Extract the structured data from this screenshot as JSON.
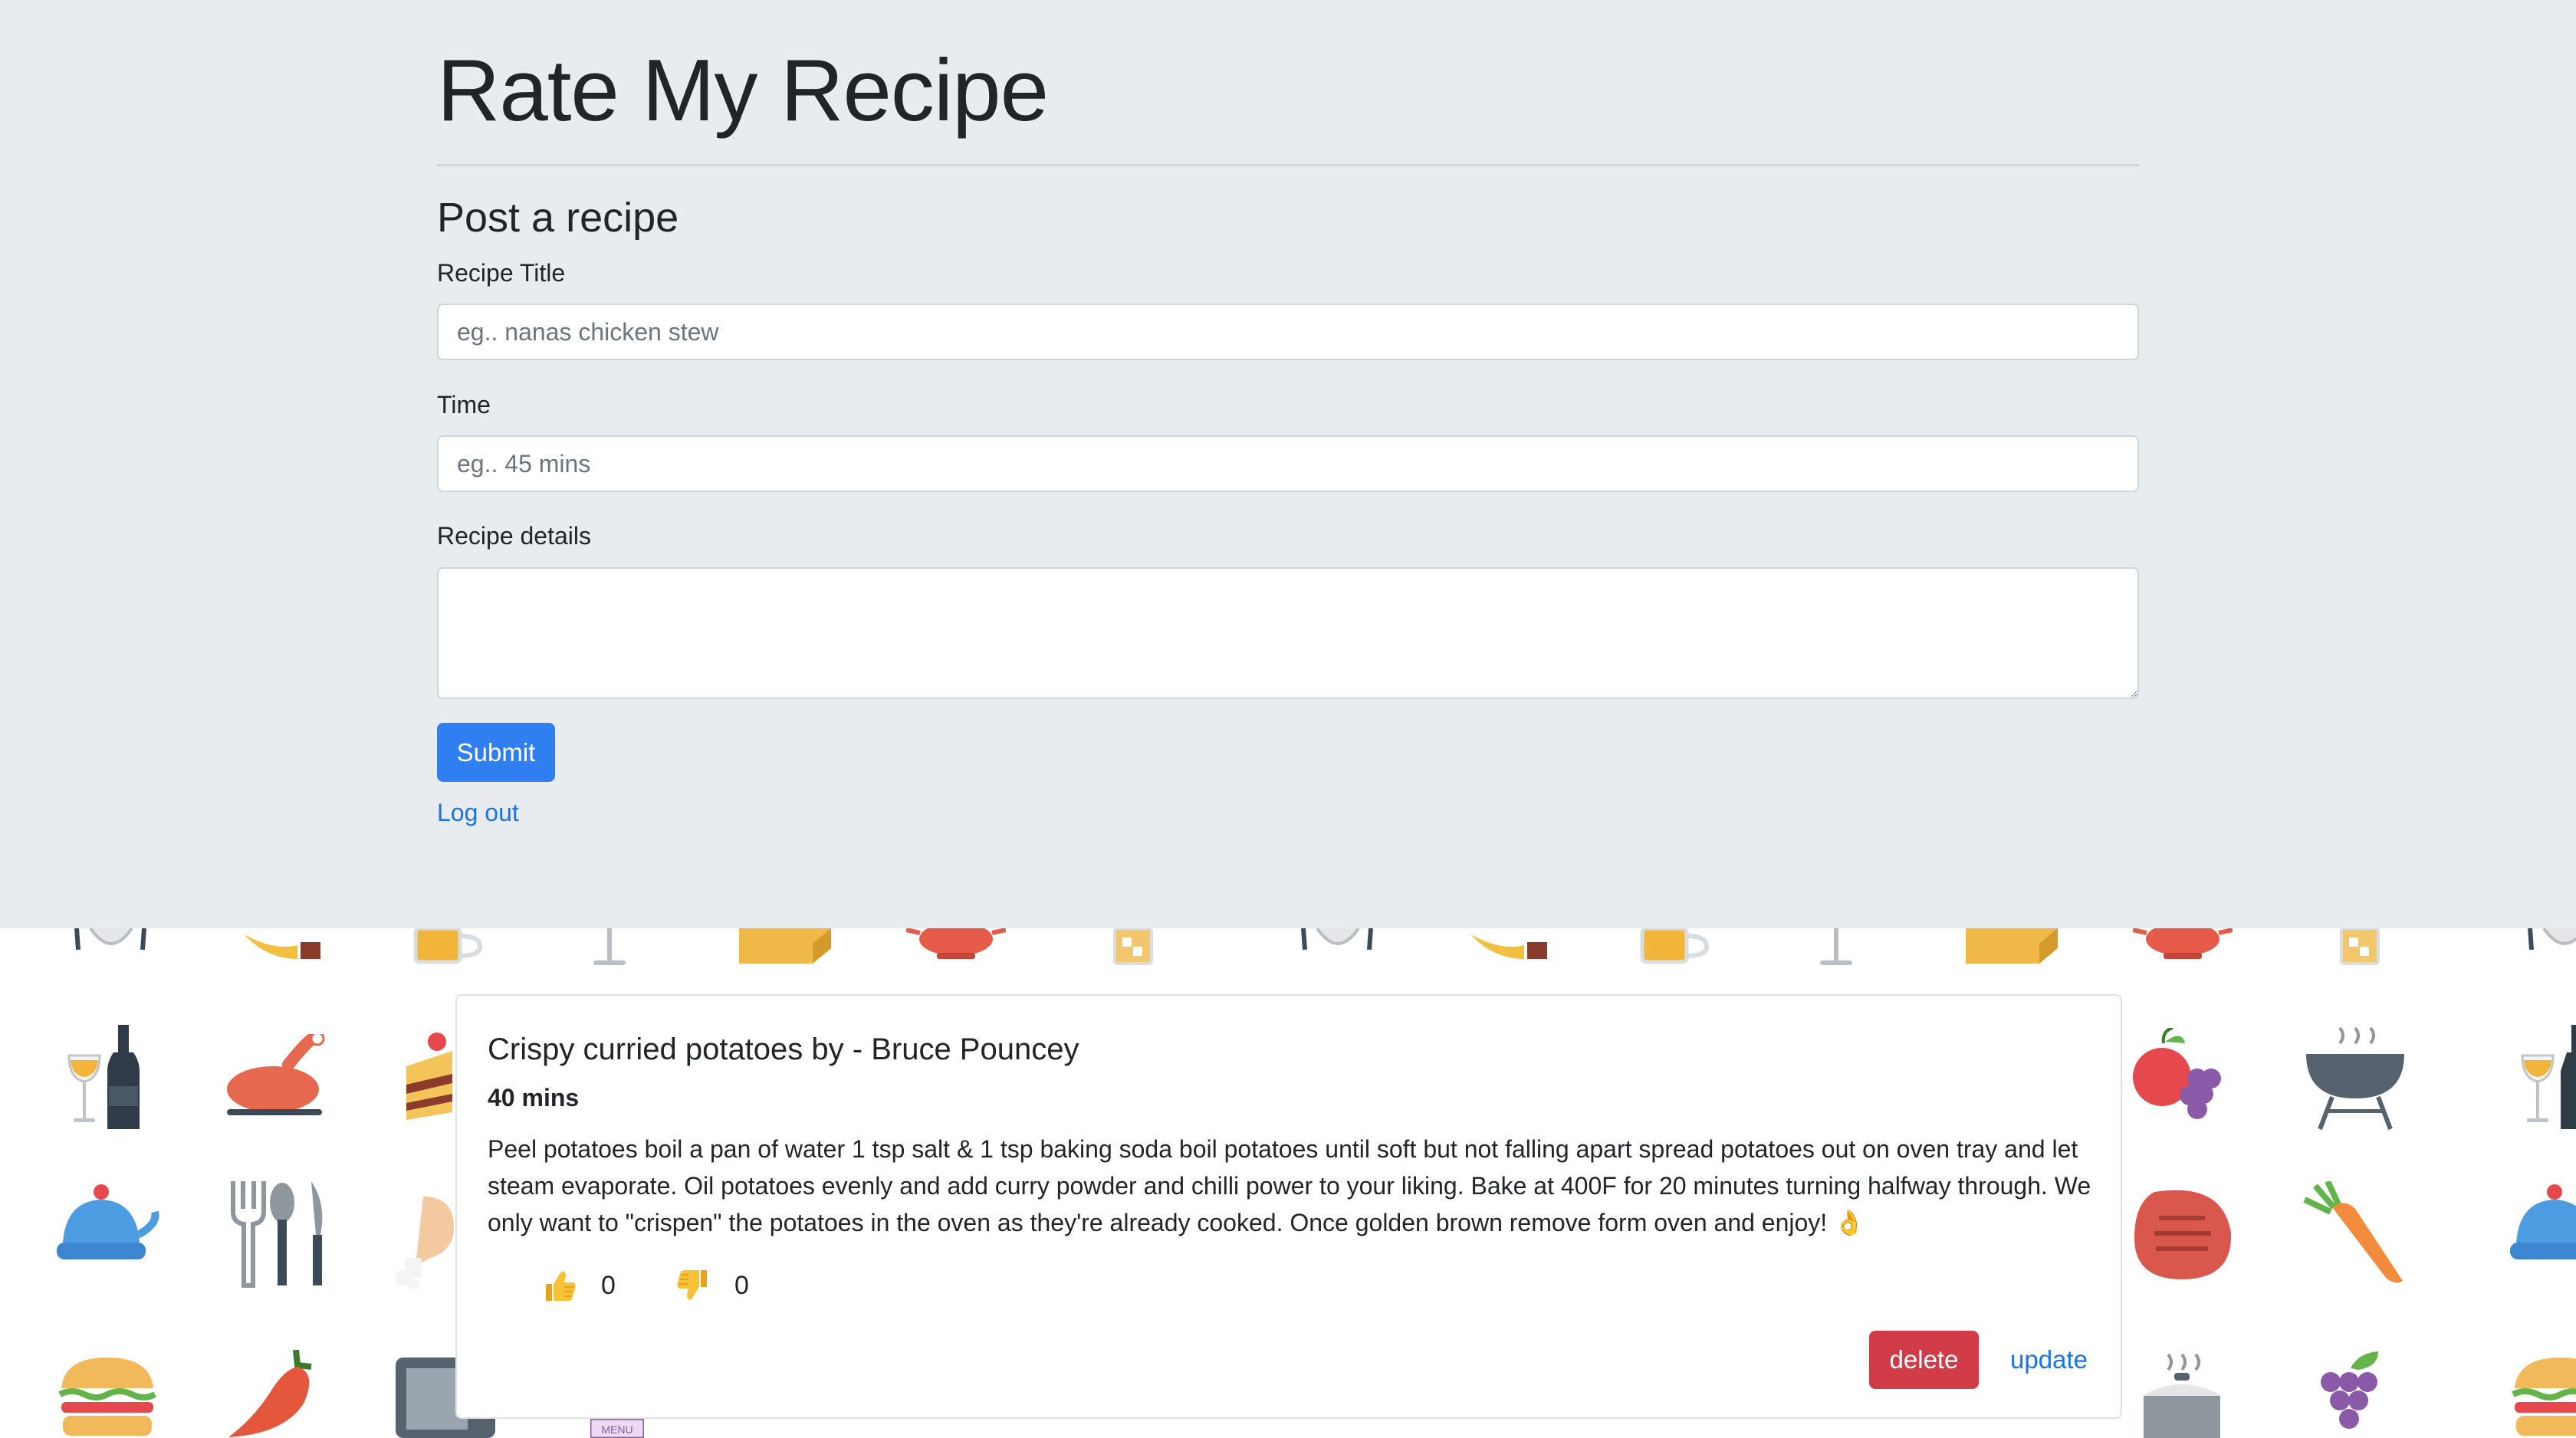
{
  "app": {
    "title": "Rate My Recipe"
  },
  "form": {
    "heading": "Post a recipe",
    "title_label": "Recipe Title",
    "title_placeholder": "eg.. nanas chicken stew",
    "title_value": "",
    "time_label": "Time",
    "time_placeholder": "eg.. 45 mins",
    "time_value": "",
    "details_label": "Recipe details",
    "details_value": "",
    "submit_label": "Submit",
    "logout_label": "Log out"
  },
  "recipes": [
    {
      "title": "Crispy curried potatoes by - Bruce Pouncey",
      "time": "40 mins",
      "details": "Peel potatoes boil a pan of water 1 tsp salt & 1 tsp baking soda boil potatoes until soft but not falling apart spread potatoes out on oven tray and let steam evaporate. Oil potatoes evenly and add curry powder and chilli power to your liking. Bake at 400F for 20 minutes turning halfway through. We only want to \"crispen\" the potatoes in the oven as they're already cooked. Once golden brown remove form oven and enjoy! 👌",
      "thumbs_up_icon": "thumbs-up-icon",
      "thumbs_up_count": "0",
      "thumbs_down_icon": "thumbs-down-icon",
      "thumbs_down_count": "0",
      "delete_label": "delete",
      "update_label": "update"
    }
  ],
  "background": {
    "pattern": "food-icons",
    "icons": [
      "plate-icon",
      "pie-slice-icon",
      "beer-mug-icon",
      "cocktail-glass-icon",
      "cheese-icon",
      "teapot-icon",
      "iced-drink-icon",
      "wine-bottle-icon",
      "roast-chicken-icon",
      "cake-slice-icon",
      "apple-grapes-icon",
      "bbq-grill-icon",
      "kettle-icon",
      "cutlery-icon",
      "drumstick-icon",
      "steak-icon",
      "carrot-icon",
      "burger-icon",
      "chili-pepper-icon",
      "tv-icon",
      "menu-icon",
      "pot-icon",
      "grapes-icon"
    ]
  },
  "colors": {
    "jumbotron_bg": "#e9ecef",
    "primary": "#2f7ff0",
    "danger": "#d13b47",
    "link": "#1a73e8"
  }
}
